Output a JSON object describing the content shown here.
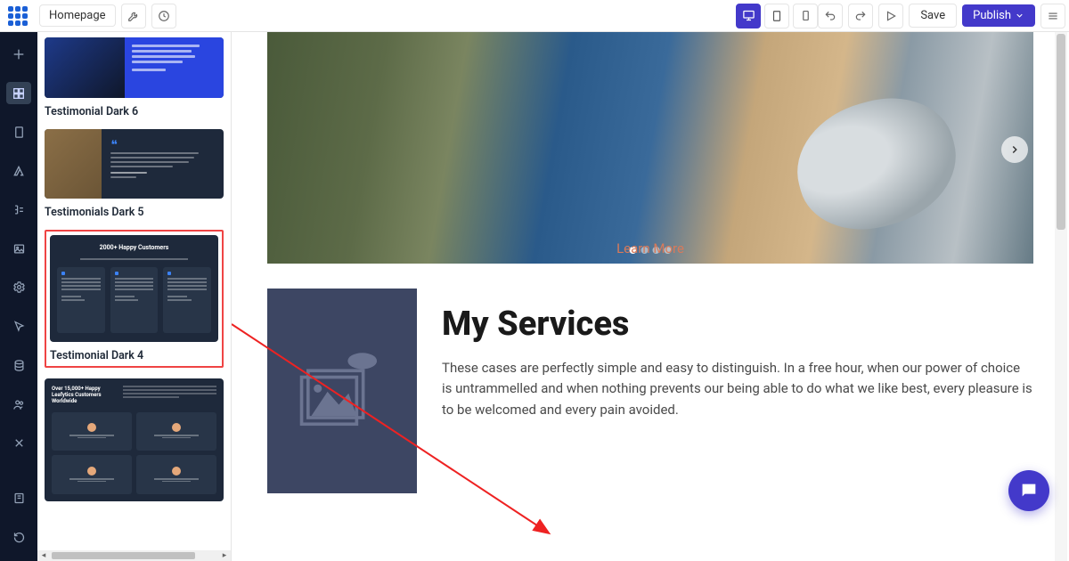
{
  "toolbar": {
    "page_name": "Homepage",
    "save_label": "Save",
    "publish_label": "Publish"
  },
  "blocks": {
    "dark6": {
      "label": "Testimonial Dark 6"
    },
    "dark5": {
      "label": "Testimonials Dark 5"
    },
    "dark4": {
      "label": "Testimonial Dark 4",
      "thumb_title": "2000+ Happy Customers"
    },
    "dark15": {
      "label": "",
      "thumb_title": "Over 15,000+ Happy Leafytics Customers Worldwide"
    }
  },
  "canvas": {
    "hero": {
      "cta": "Learn More"
    },
    "services": {
      "heading": "My Services",
      "body": "These cases are perfectly simple and easy to distinguish. In a free hour, when our power of choice is untrammelled and when nothing prevents our being able to do what we like best, every pleasure is to be welcomed and every pain avoided."
    }
  }
}
